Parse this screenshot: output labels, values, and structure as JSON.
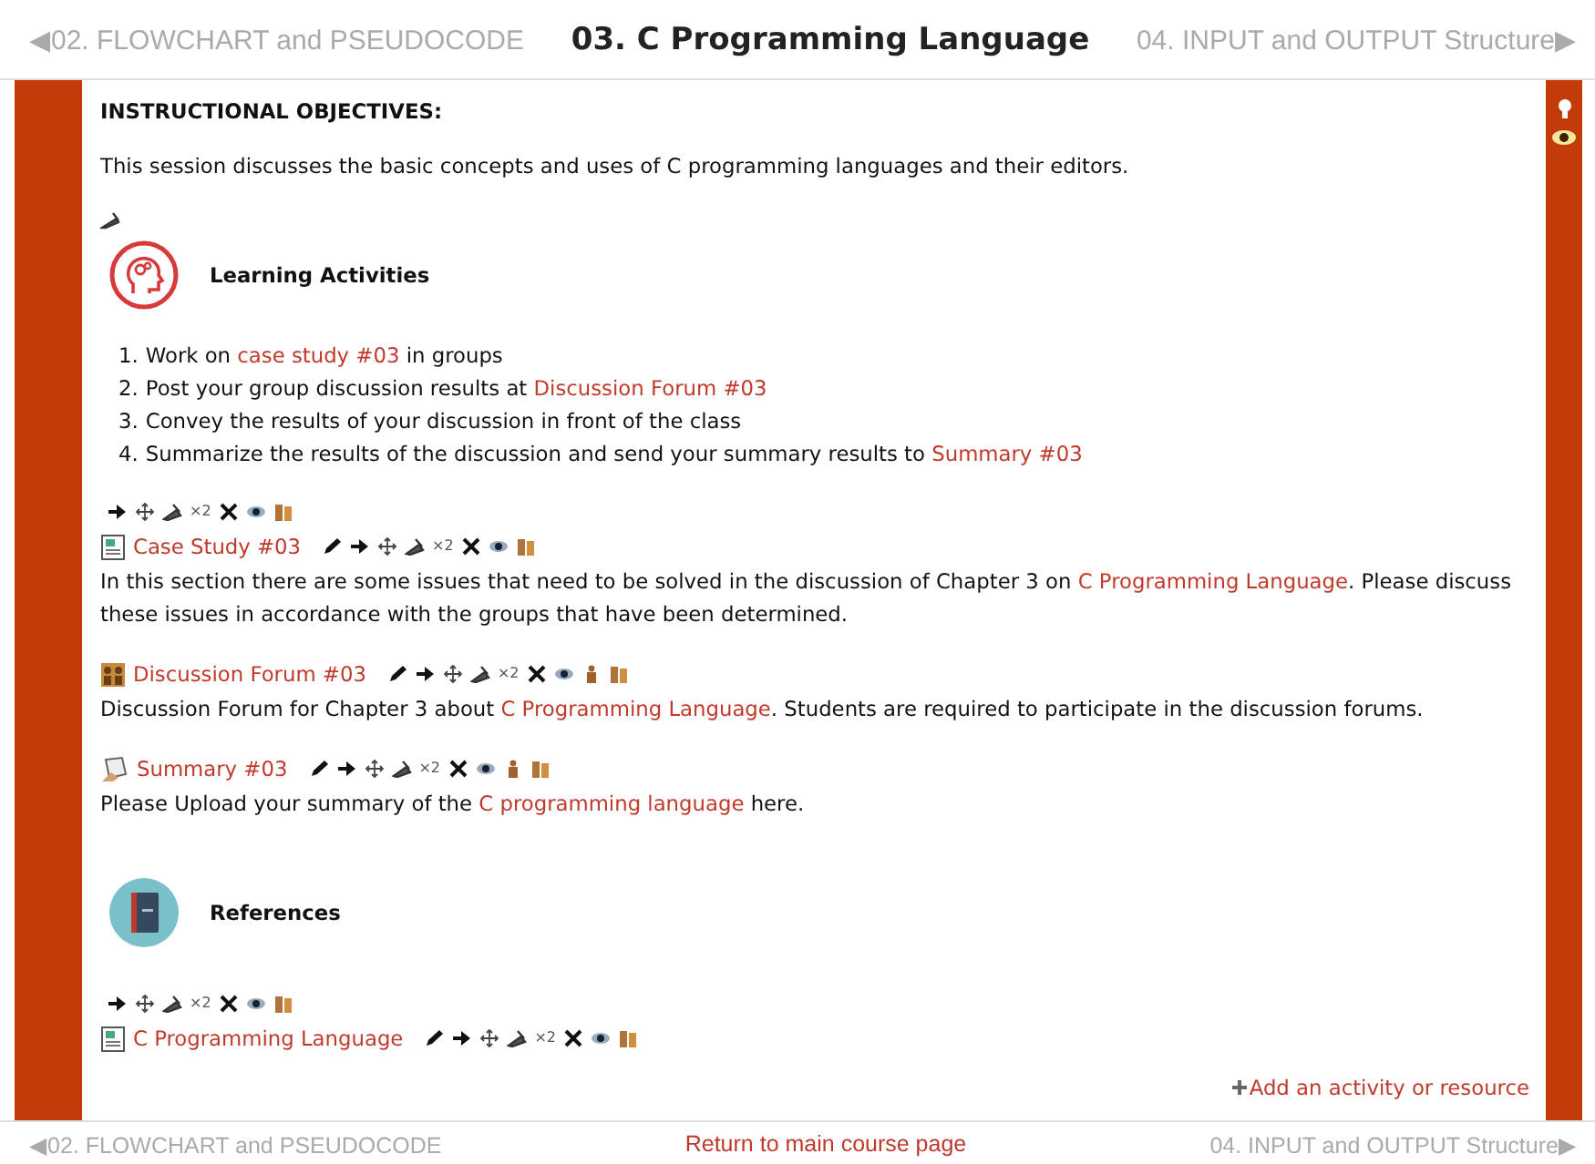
{
  "nav_top": {
    "prev": "◀02. FLOWCHART and PSEUDOCODE",
    "title": "03. C Programming Language",
    "next": "04. INPUT and OUTPUT Structure▶"
  },
  "objectives": {
    "heading": "INSTRUCTIONAL OBJECTIVES:",
    "text": "This session discusses the basic concepts and uses of C programming languages and their editors."
  },
  "blocks": [
    {
      "kind": "edit-mark"
    },
    {
      "kind": "learning",
      "title": "Learning Activities"
    },
    {
      "kind": "steps",
      "items": [
        {
          "number": "1.",
          "parts": [
            {
              "text": "Work on "
            },
            {
              "text": "case study #03",
              "link": true
            },
            {
              "text": " in groups"
            }
          ]
        },
        {
          "number": "2.",
          "parts": [
            {
              "text": "Post your group discussion results at "
            },
            {
              "text": "Discussion Forum #03",
              "link": true
            }
          ]
        },
        {
          "number": "3.",
          "parts": [
            {
              "text": "Convey the results of your discussion in front of the class"
            }
          ]
        },
        {
          "number": "4.",
          "parts": [
            {
              "text": "Summarize the results of the discussion and send your summary results to "
            },
            {
              "text": "Summary #03",
              "link": true
            }
          ]
        }
      ]
    },
    {
      "kind": "toolbar",
      "items": [
        {
          "kind": "move-right"
        },
        {
          "kind": "move"
        },
        {
          "kind": "settings"
        },
        {
          "kind": "duplicate",
          "text": "×2"
        },
        {
          "kind": "delete"
        },
        {
          "kind": "hide"
        },
        {
          "kind": "groups"
        }
      ]
    },
    {
      "kind": "page",
      "title": "Case Study #03",
      "toolbar": [
        {
          "kind": "edit"
        },
        {
          "kind": "move-right"
        },
        {
          "kind": "move"
        },
        {
          "kind": "settings"
        },
        {
          "kind": "duplicate",
          "text": "×2"
        },
        {
          "kind": "delete"
        },
        {
          "kind": "hide"
        },
        {
          "kind": "groups"
        }
      ],
      "description": [
        {
          "text": "In this section there are some issues that need to be solved in the discussion of Chapter 3 on "
        },
        {
          "text": "C Programming Language",
          "link": true
        },
        {
          "text": ". Please discuss these issues in accordance with the groups that have been determined."
        }
      ]
    },
    {
      "kind": "forum",
      "title": "Discussion Forum #03",
      "toolbar": [
        {
          "kind": "edit"
        },
        {
          "kind": "move-right"
        },
        {
          "kind": "move"
        },
        {
          "kind": "settings"
        },
        {
          "kind": "duplicate",
          "text": "×2"
        },
        {
          "kind": "delete"
        },
        {
          "kind": "hide"
        },
        {
          "kind": "roles"
        },
        {
          "kind": "groups"
        }
      ],
      "description": [
        {
          "text": "Discussion Forum for Chapter 3 about "
        },
        {
          "text": "C Programming Language",
          "link": true
        },
        {
          "text": ". Students are required to participate in the discussion forums."
        }
      ]
    },
    {
      "kind": "assignment",
      "title": "Summary #03",
      "toolbar": [
        {
          "kind": "edit"
        },
        {
          "kind": "move-right"
        },
        {
          "kind": "move"
        },
        {
          "kind": "settings"
        },
        {
          "kind": "duplicate",
          "text": "×2"
        },
        {
          "kind": "delete"
        },
        {
          "kind": "hide"
        },
        {
          "kind": "roles"
        },
        {
          "kind": "groups"
        }
      ],
      "description": [
        {
          "text": "Please Upload your summary of the "
        },
        {
          "text": "C programming language",
          "link": true
        },
        {
          "text": " here."
        }
      ]
    },
    {
      "kind": "references",
      "title": "References"
    },
    {
      "kind": "toolbar",
      "items": [
        {
          "kind": "move-right"
        },
        {
          "kind": "move"
        },
        {
          "kind": "settings"
        },
        {
          "kind": "duplicate",
          "text": "×2"
        },
        {
          "kind": "delete"
        },
        {
          "kind": "hide"
        },
        {
          "kind": "groups"
        }
      ]
    },
    {
      "kind": "page",
      "title": "C Programming Language",
      "toolbar": [
        {
          "kind": "edit"
        },
        {
          "kind": "move-right"
        },
        {
          "kind": "move"
        },
        {
          "kind": "settings"
        },
        {
          "kind": "duplicate",
          "text": "×2"
        },
        {
          "kind": "delete"
        },
        {
          "kind": "hide"
        },
        {
          "kind": "groups"
        }
      ]
    },
    {
      "kind": "add-link",
      "text": "Add an activity or resource"
    }
  ],
  "nav_bottom": {
    "prev": "◀02. FLOWCHART and PSEUDOCODE",
    "center": "Return to main course page",
    "next": "04. INPUT and OUTPUT Structure▶"
  }
}
